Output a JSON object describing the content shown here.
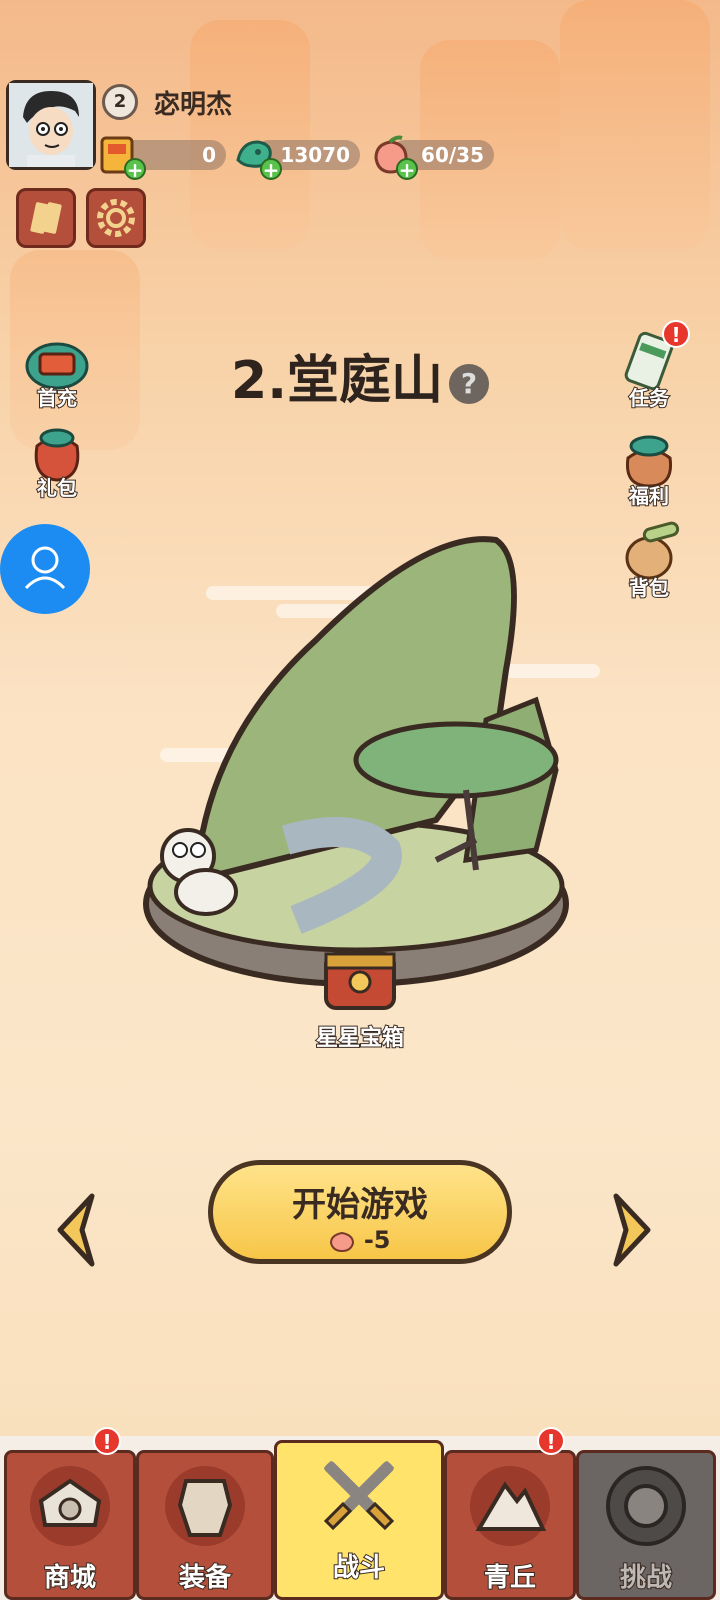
{
  "player": {
    "level": "2",
    "name": "宓明杰"
  },
  "resources": [
    {
      "icon": "ticket-icon",
      "value": "0"
    },
    {
      "icon": "jade-coin-icon",
      "value": "13070"
    },
    {
      "icon": "peach-icon",
      "value": "60/35"
    }
  ],
  "top_buttons": [
    {
      "icon": "cards-icon"
    },
    {
      "icon": "settings-gear-icon"
    }
  ],
  "left_menu": [
    {
      "label": "首充",
      "icon": "first-recharge-icon"
    },
    {
      "label": "礼包",
      "icon": "gift-bag-icon"
    }
  ],
  "right_menu": [
    {
      "label": "任务",
      "icon": "scroll-task-icon",
      "badge": "!"
    },
    {
      "label": "福利",
      "icon": "welfare-bag-icon"
    },
    {
      "label": "背包",
      "icon": "backpack-icon"
    }
  ],
  "stage": {
    "title": "2.堂庭山",
    "help": "?",
    "chest_label": "星星宝箱"
  },
  "start_button": {
    "label": "开始游戏",
    "cost": "-5"
  },
  "nav": [
    {
      "label": "商城",
      "icon": "shop-icon",
      "badge": "!"
    },
    {
      "label": "装备",
      "icon": "armor-icon"
    },
    {
      "label": "战斗",
      "icon": "crossed-swords-icon",
      "active": true
    },
    {
      "label": "青丘",
      "icon": "mountain-icon",
      "badge": "!"
    },
    {
      "label": "挑战",
      "icon": "challenge-orb-icon",
      "locked": true
    }
  ],
  "colors": {
    "accent": "#f7c648",
    "nav_red": "#b44f3b",
    "nav_active": "#ffe36b",
    "nav_locked": "#6b6663",
    "badge": "#e7372c"
  }
}
